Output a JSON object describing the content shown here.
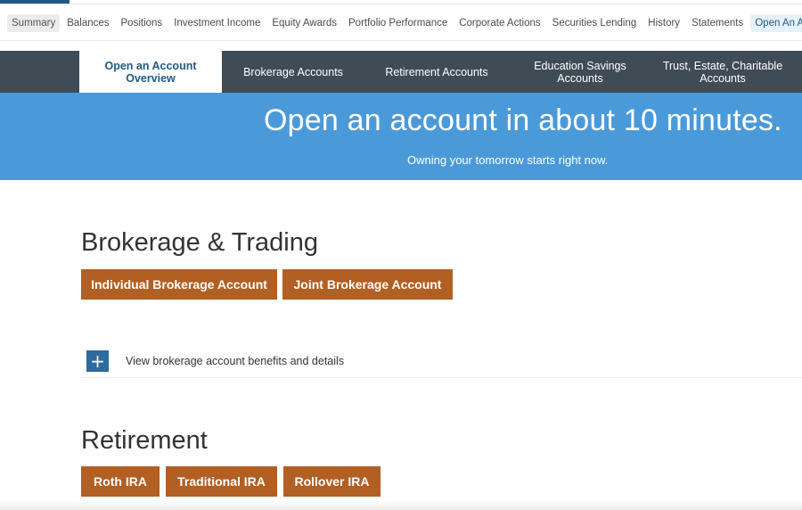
{
  "subnav": {
    "items": [
      {
        "label": "Summary"
      },
      {
        "label": "Balances"
      },
      {
        "label": "Positions"
      },
      {
        "label": "Investment Income"
      },
      {
        "label": "Equity Awards"
      },
      {
        "label": "Portfolio Performance"
      },
      {
        "label": "Corporate Actions"
      },
      {
        "label": "Securities Lending"
      },
      {
        "label": "History"
      },
      {
        "label": "Statements"
      },
      {
        "label": "Open An Account"
      }
    ],
    "selected": "Open An Account"
  },
  "tabs": [
    {
      "line1": "Open an Account",
      "line2": "Overview",
      "active": true
    },
    {
      "line1": "Brokerage Accounts",
      "line2": ""
    },
    {
      "line1": "Retirement Accounts",
      "line2": ""
    },
    {
      "line1": "Education Savings",
      "line2": "Accounts"
    },
    {
      "line1": "Trust, Estate, Charitable",
      "line2": "Accounts"
    }
  ],
  "hero": {
    "title": "Open an account in about 10 minutes.",
    "subtitle": "Owning your tomorrow starts right now."
  },
  "brokerage": {
    "title": "Brokerage & Trading",
    "buttons": [
      "Individual Brokerage Account",
      "Joint Brokerage Account"
    ],
    "details_label": "View brokerage account benefits and details",
    "details_icon": "plus-icon"
  },
  "retirement": {
    "title": "Retirement",
    "buttons": [
      "Roth IRA",
      "Traditional IRA",
      "Rollover IRA"
    ]
  },
  "colors": {
    "tabbar": "#3f4b55",
    "hero": "#4a9ad9",
    "button": "#b25f23",
    "accent": "#1e5a86"
  }
}
